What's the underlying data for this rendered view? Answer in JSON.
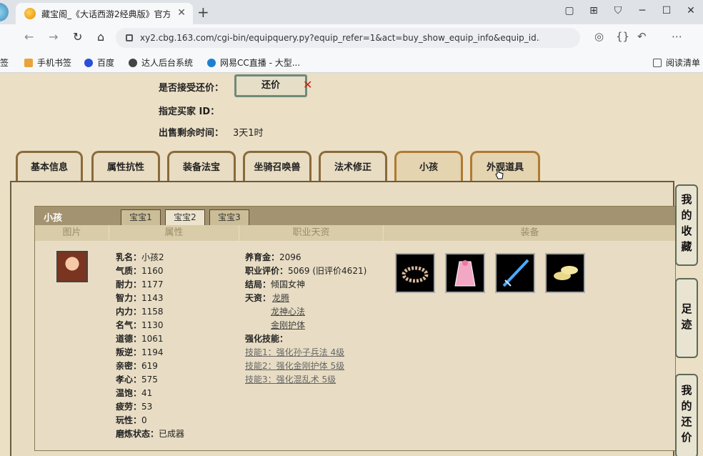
{
  "browser": {
    "tab_title": "藏宝阁_《大话西游2经典版》官方",
    "url": "xy2.cbg.163.com/cgi-bin/equipquery.py?equip_refer=1&act=buy_show_equip_info&equip_id...",
    "bookmarks": [
      "签",
      "手机书签",
      "百度",
      "达人后台系统",
      "网易CC直播 - 大型...",
      "阅读清单"
    ]
  },
  "info": {
    "accept_counter_label": "是否接受还价：",
    "counter_button": "还价",
    "buyer_label": "指定买家 ID：",
    "time_label": "出售剩余时间：",
    "time_value": "3天1时"
  },
  "tabs": [
    "基本信息",
    "属性抗性",
    "装备法宝",
    "坐骑召唤兽",
    "法术修正",
    "小孩",
    "外观道具"
  ],
  "child": {
    "section_title": "小孩",
    "subtabs": [
      "宝宝1",
      "宝宝2",
      "宝宝3"
    ],
    "columns": [
      "图片",
      "属性",
      "职业天资",
      "装备"
    ],
    "attributes": [
      {
        "k": "乳名：",
        "v": "小孩2"
      },
      {
        "k": "气质：",
        "v": "1160"
      },
      {
        "k": "耐力：",
        "v": "1177"
      },
      {
        "k": "智力：",
        "v": "1143"
      },
      {
        "k": "内力：",
        "v": "1158"
      },
      {
        "k": "名气：",
        "v": "1130"
      },
      {
        "k": "道德：",
        "v": "1061"
      },
      {
        "k": "叛逆：",
        "v": "1194"
      },
      {
        "k": "亲密：",
        "v": "619"
      },
      {
        "k": "孝心：",
        "v": "575"
      },
      {
        "k": "温饱：",
        "v": "41"
      },
      {
        "k": "疲劳：",
        "v": "53"
      },
      {
        "k": "玩性：",
        "v": "0"
      },
      {
        "k": "磨炼状态：",
        "v": "已成器"
      }
    ],
    "job": {
      "fund_label": "养育金：",
      "fund": "2096",
      "eval_label": "职业评价：",
      "eval": "5069 (旧评价4621)",
      "ending_label": "结局：",
      "ending": "倾国女神",
      "talent_label": "天资：",
      "talents": [
        "龙腾",
        "龙神心法",
        "金刚护体"
      ],
      "skills_label": "强化技能：",
      "skills": [
        "技能1：强化孙子兵法 4级",
        "技能2：强化金刚护体 5级",
        "技能3：强化混乱术 5级"
      ]
    },
    "equipment_icons": [
      "wreath-icon",
      "pink-robe-icon",
      "blue-sword-icon",
      "golden-shoes-icon"
    ]
  },
  "side": {
    "favorites": "我的收藏",
    "footprints": "足迹",
    "counter_offers": "我的还价"
  }
}
